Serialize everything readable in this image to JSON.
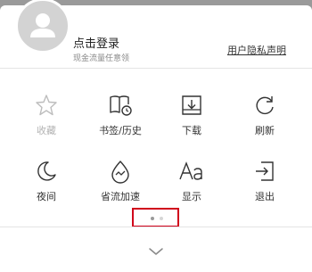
{
  "header": {
    "login_title": "点击登录",
    "login_subtitle": "现金流量任意领",
    "privacy_link": "用户隐私声明"
  },
  "menu": {
    "items": [
      {
        "label": "收藏",
        "icon": "star-icon",
        "enabled": false
      },
      {
        "label": "书签/历史",
        "icon": "book-clock-icon",
        "enabled": true
      },
      {
        "label": "下载",
        "icon": "download-tray-icon",
        "enabled": true
      },
      {
        "label": "刷新",
        "icon": "refresh-icon",
        "enabled": true
      },
      {
        "label": "夜间",
        "icon": "moon-icon",
        "enabled": true
      },
      {
        "label": "省流加速",
        "icon": "data-saver-icon",
        "enabled": true
      },
      {
        "label": "显示",
        "icon": "font-size-icon",
        "enabled": true
      },
      {
        "label": "退出",
        "icon": "exit-icon",
        "enabled": true
      }
    ]
  },
  "pager": {
    "pages": 2,
    "current": 1
  },
  "colors": {
    "highlight_box": "#d0021b",
    "top_band": "#9a9a9a",
    "disabled_text": "#b3b3b3"
  }
}
